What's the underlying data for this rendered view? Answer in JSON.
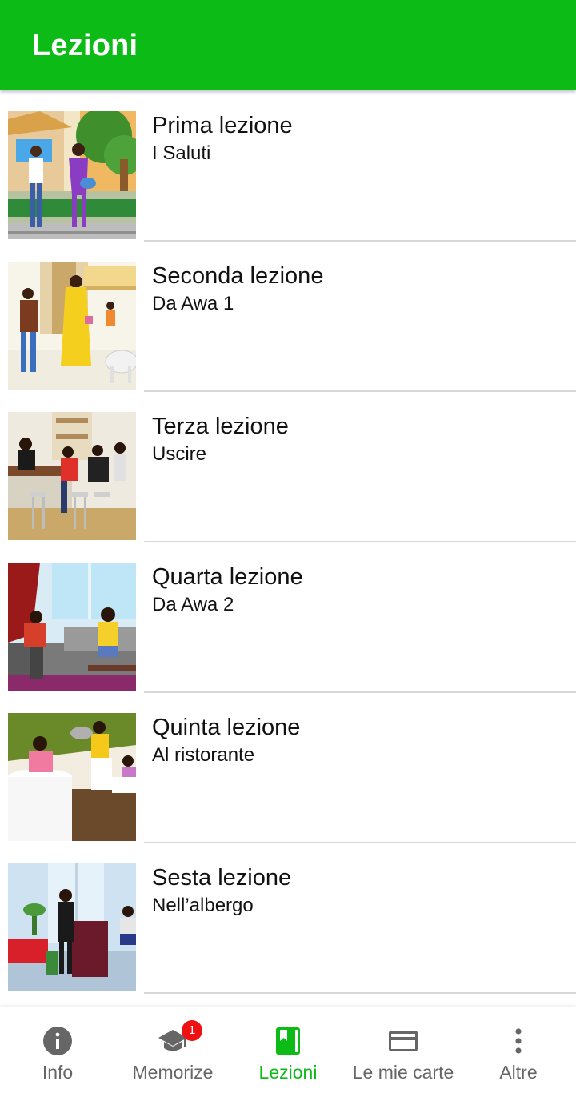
{
  "app_bar": {
    "title": "Lezioni"
  },
  "lessons": [
    {
      "title": "Prima lezione",
      "subtitle": "I Saluti",
      "thumbnail": "illustration-greeting-street"
    },
    {
      "title": "Seconda lezione",
      "subtitle": "Da Awa 1",
      "thumbnail": "illustration-house-visit"
    },
    {
      "title": "Terza lezione",
      "subtitle": "Uscire",
      "thumbnail": "illustration-bar"
    },
    {
      "title": "Quarta lezione",
      "subtitle": "Da Awa 2",
      "thumbnail": "illustration-living-room"
    },
    {
      "title": "Quinta lezione",
      "subtitle": "Al ristorante",
      "thumbnail": "illustration-restaurant"
    },
    {
      "title": "Sesta lezione",
      "subtitle": "Nell’albergo",
      "thumbnail": "illustration-hotel"
    }
  ],
  "bottom_nav": {
    "items": [
      {
        "label": "Info",
        "icon": "info-icon"
      },
      {
        "label": "Memorize",
        "icon": "graduation-cap-icon",
        "badge": "1"
      },
      {
        "label": "Lezioni",
        "icon": "book-icon",
        "active": true
      },
      {
        "label": "Le mie carte",
        "icon": "card-icon"
      },
      {
        "label": "Altre",
        "icon": "more-vertical-icon"
      }
    ]
  },
  "colors": {
    "primary": "#0dbb17",
    "badge": "#ee1111",
    "inactive": "#666666"
  }
}
